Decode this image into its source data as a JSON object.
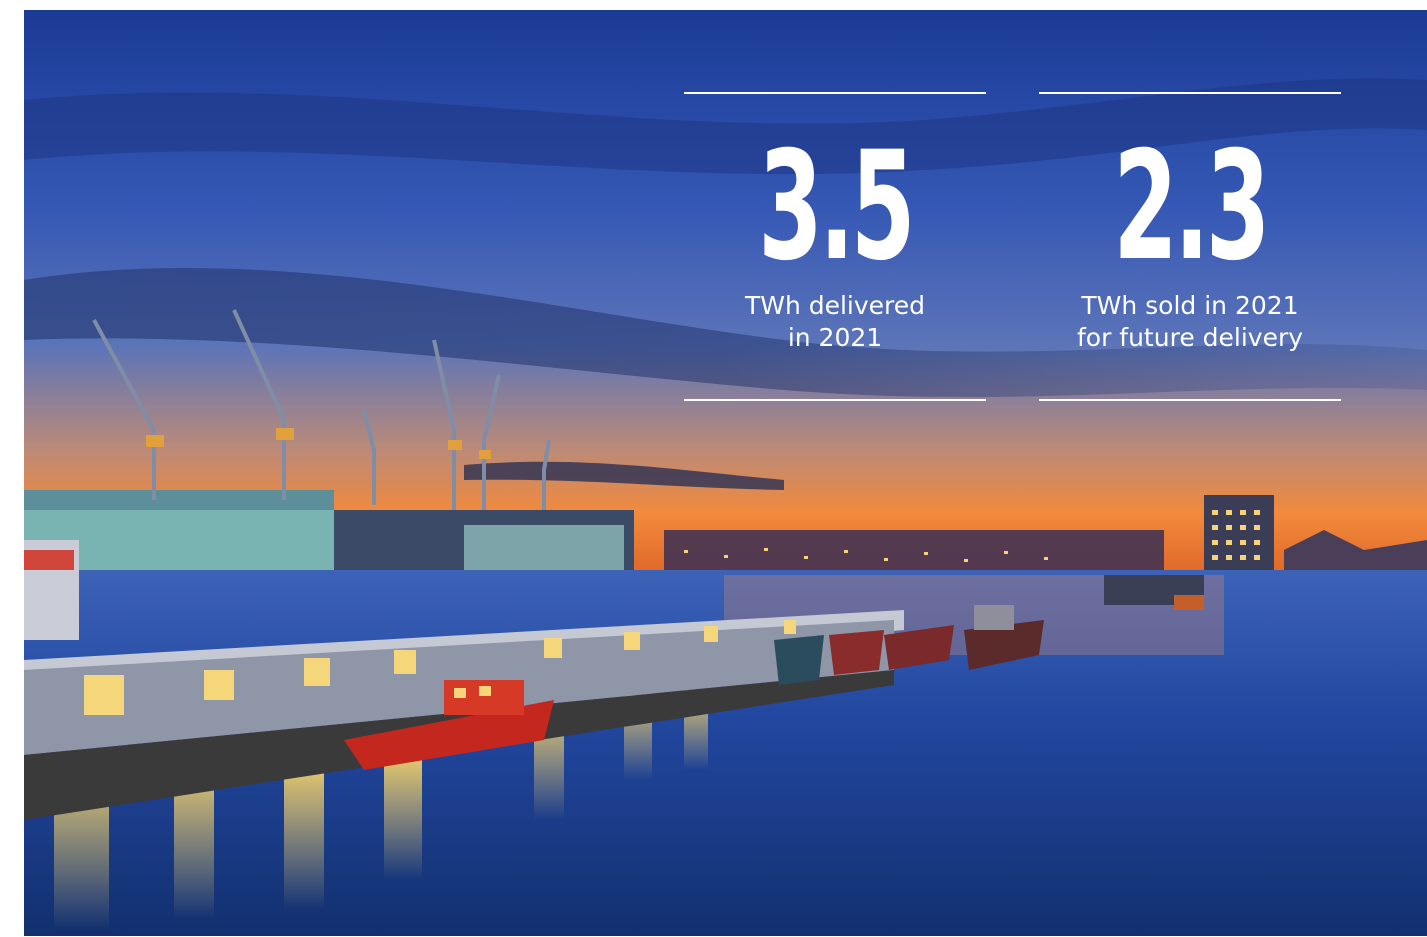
{
  "stats": [
    {
      "value": "3.5",
      "caption_line1": "TWh delivered",
      "caption_line2": "in 2021"
    },
    {
      "value": "2.3",
      "caption_line1": "TWh sold in 2021",
      "caption_line2": "for future delivery"
    }
  ],
  "colors": {
    "text": "#ffffff",
    "sky_top": "#1f3f9a",
    "sky_mid": "#3e5fb8",
    "sunset": "#f08a3a",
    "water": "#1b3f8f"
  }
}
